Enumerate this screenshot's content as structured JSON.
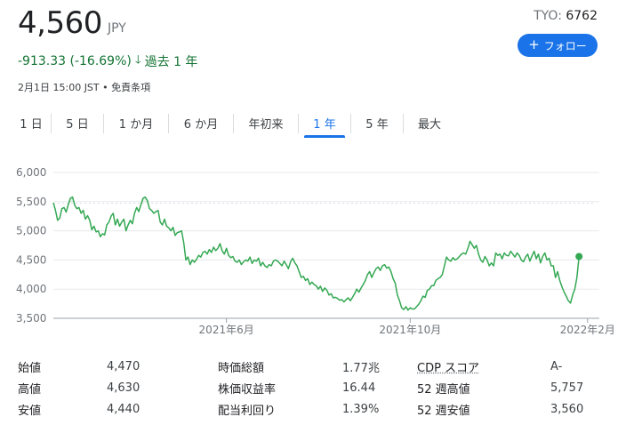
{
  "header": {
    "price": "4,560",
    "currency": "JPY",
    "ticker_prefix": "TYO:",
    "ticker_code": "6762",
    "follow_label": "フォロー",
    "change_text": "-913.33 (-16.69%)",
    "change_period": "過去 1 年",
    "meta": "2月1日 15:00 JST • 免責条項",
    "accent_color": "#1a73e8",
    "change_color": "#137333"
  },
  "tabs": [
    {
      "label": "1 日",
      "active": false
    },
    {
      "label": "5 日",
      "active": false
    },
    {
      "label": "1 か月",
      "active": false
    },
    {
      "label": "6 か月",
      "active": false
    },
    {
      "label": "年初来",
      "active": false
    },
    {
      "label": "1 年",
      "active": true
    },
    {
      "label": "5 年",
      "active": false
    },
    {
      "label": "最大",
      "active": false
    }
  ],
  "chart_data": {
    "type": "area",
    "line_color": "#34a853",
    "ylim": [
      3500,
      6000
    ],
    "yticks": [
      3500,
      4000,
      4500,
      5000,
      5500,
      6000
    ],
    "ytick_labels": [
      "3,500",
      "4,000",
      "4,500",
      "5,000",
      "5,500",
      "6,000"
    ],
    "xlim": [
      0,
      253
    ],
    "xticks": [
      {
        "x": 81,
        "label": "2021年6月"
      },
      {
        "x": 167,
        "label": "2021年10月"
      },
      {
        "x": 250,
        "label": "2022年2月"
      }
    ],
    "grid": true,
    "baseline": 5473,
    "values": [
      5480,
      5350,
      5180,
      5220,
      5380,
      5400,
      5320,
      5450,
      5560,
      5580,
      5440,
      5380,
      5400,
      5300,
      5350,
      5200,
      5260,
      5180,
      5020,
      5080,
      4980,
      5000,
      4900,
      4950,
      4930,
      5100,
      5150,
      5250,
      5300,
      5100,
      5200,
      5080,
      5150,
      5200,
      5000,
      5100,
      5180,
      5120,
      5300,
      5400,
      5330,
      5450,
      5560,
      5580,
      5520,
      5380,
      5350,
      5300,
      5330,
      5350,
      5150,
      5100,
      5200,
      5080,
      5050,
      5000,
      5060,
      4920,
      4970,
      4980,
      5000,
      4800,
      4500,
      4550,
      4420,
      4500,
      4460,
      4510,
      4580,
      4550,
      4630,
      4650,
      4600,
      4680,
      4630,
      4720,
      4660,
      4700,
      4780,
      4660,
      4600,
      4700,
      4580,
      4540,
      4560,
      4480,
      4460,
      4500,
      4420,
      4470,
      4500,
      4480,
      4550,
      4440,
      4500,
      4480,
      4530,
      4400,
      4460,
      4400,
      4370,
      4420,
      4400,
      4480,
      4500,
      4480,
      4440,
      4400,
      4480,
      4420,
      4350,
      4470,
      4530,
      4450,
      4400,
      4300,
      4200,
      4220,
      4150,
      4180,
      4080,
      4120,
      4080,
      4060,
      4000,
      4050,
      3960,
      4020,
      3980,
      3900,
      3920,
      3850,
      3860,
      3840,
      3810,
      3820,
      3780,
      3820,
      3850,
      3800,
      3860,
      3920,
      4000,
      3950,
      4020,
      4080,
      4150,
      4250,
      4300,
      4200,
      4280,
      4350,
      4380,
      4320,
      4400,
      4420,
      4360,
      4380,
      4300,
      4180,
      4100,
      3900,
      3800,
      3680,
      3650,
      3700,
      3640,
      3680,
      3660,
      3660,
      3700,
      3740,
      3800,
      3880,
      3860,
      3980,
      4000,
      4060,
      4060,
      4150,
      4180,
      4200,
      4250,
      4400,
      4550,
      4500,
      4480,
      4540,
      4500,
      4520,
      4560,
      4600,
      4620,
      4600,
      4700,
      4820,
      4760,
      4700,
      4750,
      4600,
      4500,
      4460,
      4560,
      4500,
      4400,
      4450,
      4400,
      4620,
      4580,
      4600,
      4520,
      4620,
      4580,
      4570,
      4650,
      4600,
      4550,
      4620,
      4580,
      4500,
      4470,
      4550,
      4600,
      4480,
      4570,
      4650,
      4520,
      4600,
      4450,
      4560,
      4620,
      4500,
      4530,
      4400,
      4400,
      4200,
      4300,
      4150,
      4040,
      3950,
      3880,
      3800,
      3760,
      3900,
      4000,
      4200,
      4560
    ],
    "last_point": 4560
  },
  "stats": [
    {
      "l1": "始値",
      "v1": "4,470",
      "l2": "時価総額",
      "v2": "1.77兆",
      "l3": "CDP スコア",
      "v3": "A-"
    },
    {
      "l1": "高値",
      "v1": "4,630",
      "l2": "株価収益率",
      "v2": "16.44",
      "l3": "52 週高値",
      "v3": "5,757"
    },
    {
      "l1": "安値",
      "v1": "4,440",
      "l2": "配当利回り",
      "v2": "1.39%",
      "l3": "52 週安値",
      "v3": "3,560"
    }
  ]
}
